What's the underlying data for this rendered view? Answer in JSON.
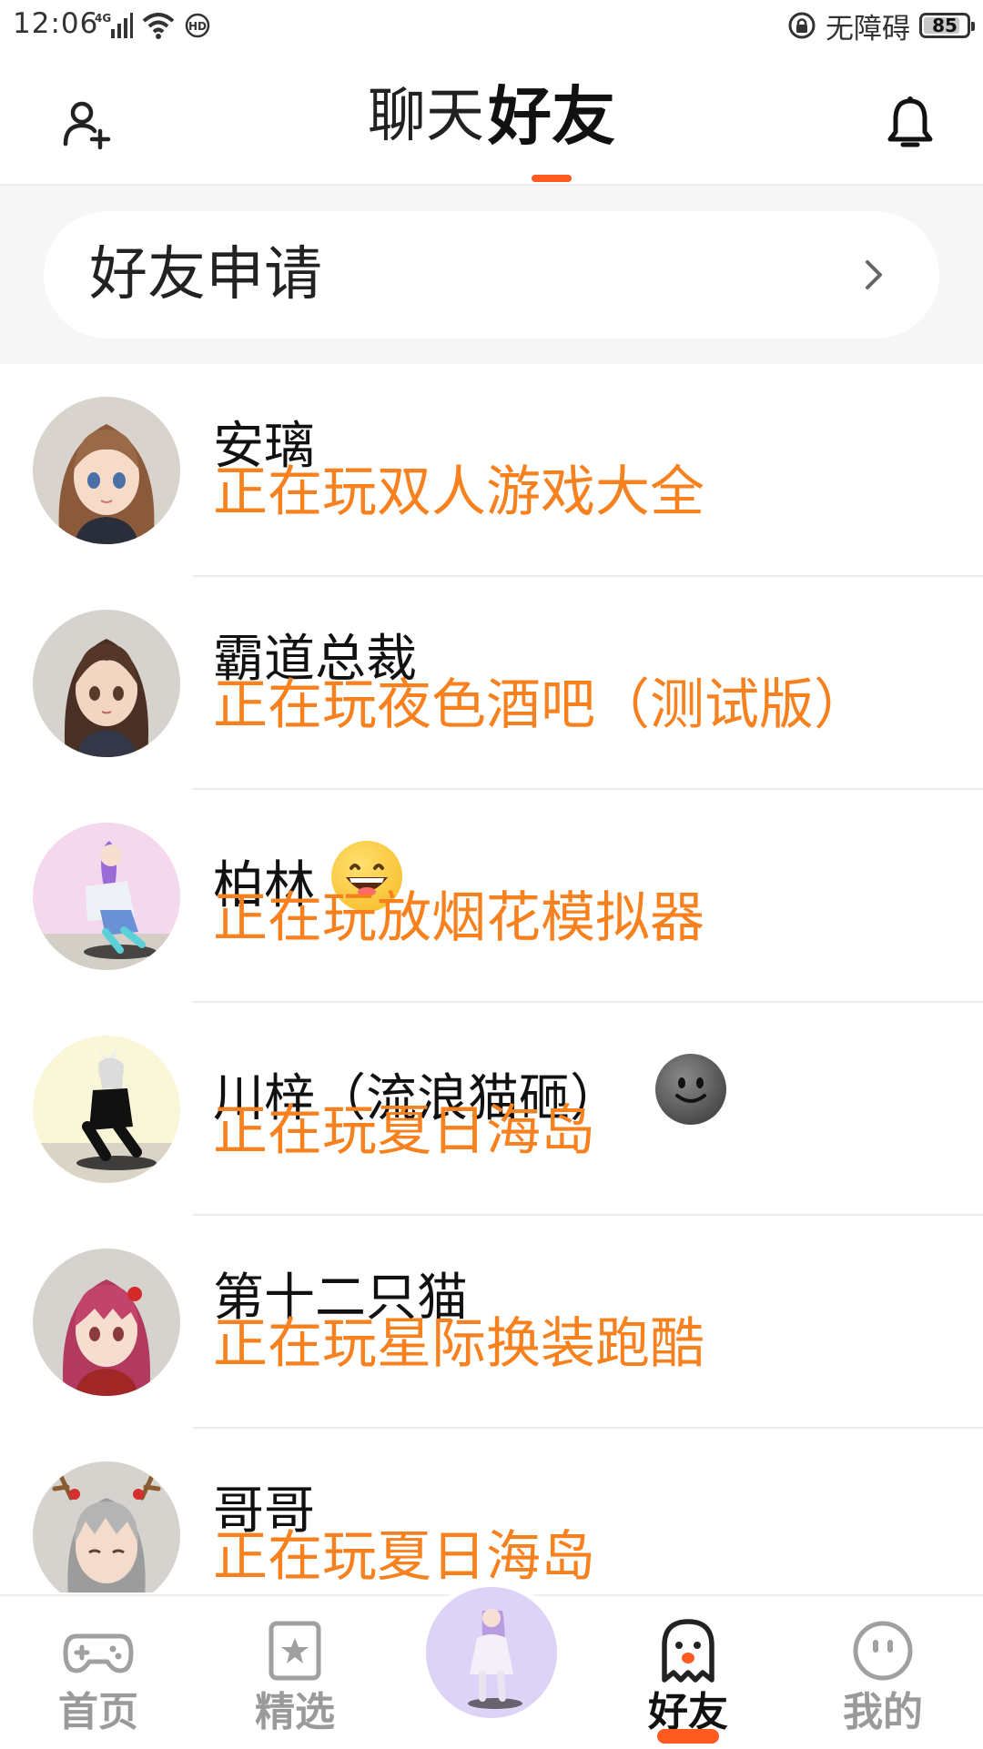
{
  "status_bar": {
    "time": "12:06",
    "network": "4G",
    "accessibility_text": "无障碍",
    "battery_level": "85",
    "battery_fraction": 0.85
  },
  "header": {
    "tabs": [
      {
        "label": "聊天",
        "active": false
      },
      {
        "label": "好友",
        "active": true
      }
    ],
    "add_icon": "add-friend-icon",
    "bell_icon": "bell-icon",
    "accent_color": "#ff5a1f"
  },
  "friend_request": {
    "label": "好友申请"
  },
  "friends": [
    {
      "name": "安璃",
      "activity": "正在玩双人游戏大全",
      "avatar_bg": "#d8d3cc"
    },
    {
      "name": "霸道总裁",
      "activity": "正在玩夜色酒吧（测试版）",
      "avatar_bg": "#d6d2cd"
    },
    {
      "name": "柏林",
      "activity": "正在玩放烟花模拟器",
      "avatar_bg": "#f3d8ee",
      "emoji": "grinning-emoji"
    },
    {
      "name": "川梓（流浪猫砸）",
      "activity": "正在玩夏日海岛",
      "avatar_bg": "#faf6d8",
      "emoji": "dark-smiley-emoji"
    },
    {
      "name": "第十二只猫",
      "activity": "正在玩星际换装跑酷",
      "avatar_bg": "#d6d2cd"
    },
    {
      "name": "哥哥",
      "activity": "正在玩夏日海岛",
      "avatar_bg": "#d6d2cd"
    }
  ],
  "activity_color": "#f7811e",
  "bottom_nav": {
    "items": [
      {
        "label": "首页",
        "icon": "gamepad-icon",
        "active": false
      },
      {
        "label": "精选",
        "icon": "star-card-icon",
        "active": false
      },
      {
        "label": "好友",
        "icon": "ghost-icon",
        "active": true
      },
      {
        "label": "我的",
        "icon": "smiley-face-icon",
        "active": false
      }
    ],
    "center_icon": "avatar-character-icon"
  }
}
